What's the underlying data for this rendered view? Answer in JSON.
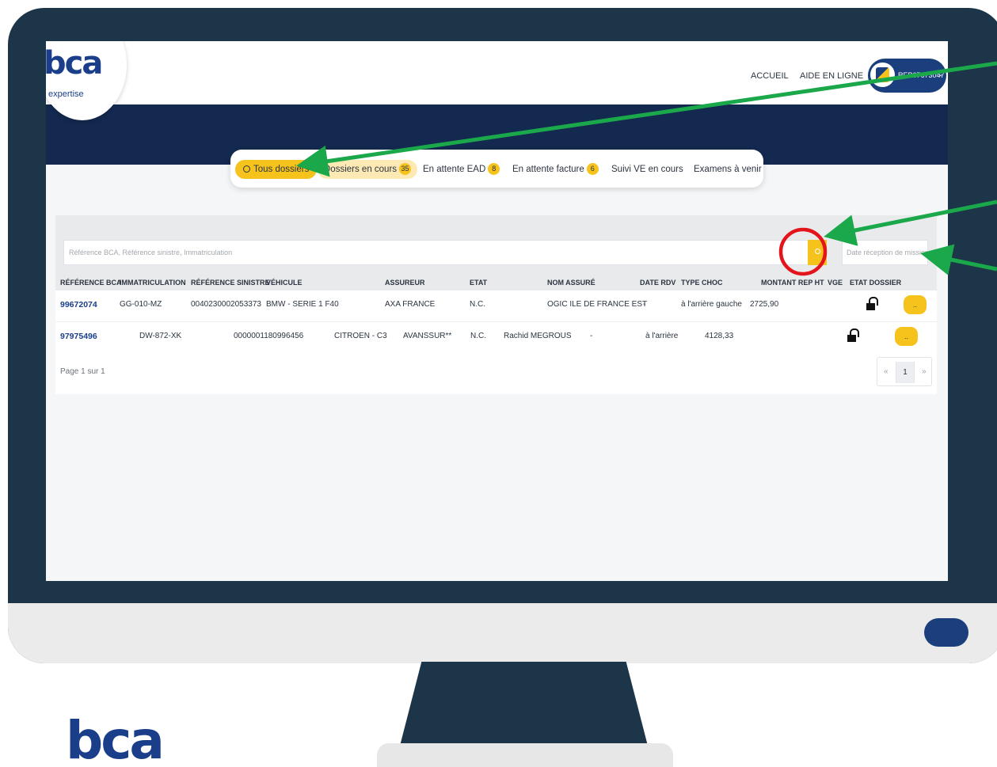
{
  "header": {
    "logo_text": "bca",
    "logo_sub": "expertise",
    "nav": [
      "ACCUEIL",
      "AIDE EN LIGNE"
    ],
    "user_id": "REP67673047",
    "user_chevron": "⌄"
  },
  "tabs": [
    {
      "label": "Tous dossiers",
      "icon": "search-icon",
      "active": true
    },
    {
      "label": "Dossiers en cours",
      "badge": "35"
    },
    {
      "label": "En attente EAD",
      "badge": "8"
    },
    {
      "label": "En attente facture",
      "badge": "6"
    },
    {
      "label": "Suivi VE en cours"
    },
    {
      "label": "Examens à venir"
    }
  ],
  "search": {
    "placeholder": "Référence BCA, Référence sinistre, Immatriculation",
    "date_placeholder": "Date réception de mission",
    "button_icon": "search-icon"
  },
  "table": {
    "columns": [
      "RÉFÉRENCE BCA",
      "IMMATRICULATION",
      "RÉFÉRENCE SINISTRE",
      "VÉHICULE",
      "ASSUREUR",
      "ETAT",
      "NOM ASSURÉ",
      "DATE RDV",
      "TYPE CHOC",
      "MONTANT REP HT",
      "VGE",
      "ETAT DOSSIER"
    ],
    "rows": [
      {
        "ref": "99672074",
        "immat": "GG-010-MZ",
        "sinistre": "0040230002053373",
        "vehicule": "BMW - SERIE 1 F40",
        "assureur": "AXA FRANCE",
        "etat": "N.C.",
        "nom": "OGIC ILE DE FRANCE EST",
        "date": "-",
        "choc": "à l'arrière gauche",
        "montant": "2725,90",
        "action": ".."
      },
      {
        "ref": "97975496",
        "immat": "DW-872-XK",
        "sinistre": "0000001180996456",
        "vehicule": "CITROEN - C3",
        "assureur": "AVANSSUR**",
        "etat": "N.C.",
        "nom": "Rachid MEGROUS",
        "date": "-",
        "choc": "à l'arrière",
        "montant": "4128,33",
        "action": ".."
      }
    ]
  },
  "pagination": {
    "text": "Page 1 sur 1",
    "prev": "«",
    "current": "1",
    "next": "»"
  },
  "footer_logo": "bca",
  "colors": {
    "accent": "#f6c21c",
    "brand_blue": "#1a3e8a",
    "banner": "#13294f",
    "monitor": "#1c3548",
    "annotation_arrow": "#1aa84a",
    "annotation_circle": "#e3141b"
  }
}
